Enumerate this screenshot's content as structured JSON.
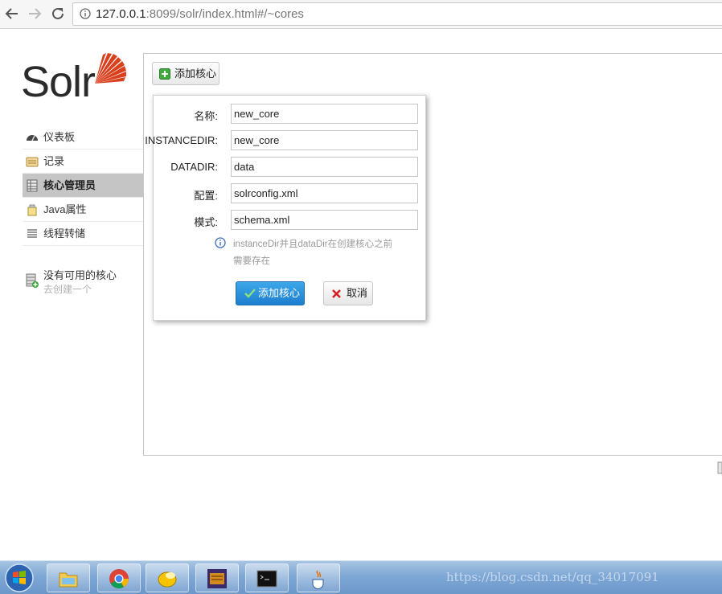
{
  "browser": {
    "url_host": "127.0.0.1",
    "url_rest": ":8099/solr/index.html#/~cores"
  },
  "logo": {
    "text": "Solr"
  },
  "sidebar": {
    "items": [
      {
        "label": "仪表板",
        "icon": "dashboard-icon"
      },
      {
        "label": "记录",
        "icon": "logging-icon"
      },
      {
        "label": "核心管理员",
        "icon": "core-admin-icon",
        "active": true
      },
      {
        "label": "Java属性",
        "icon": "java-properties-icon"
      },
      {
        "label": "线程转储",
        "icon": "thread-dump-icon"
      }
    ],
    "no_core": {
      "title": "没有可用的核心",
      "subtitle": "去创建一个"
    }
  },
  "toolbar": {
    "add_core_label": "添加核心"
  },
  "dialog": {
    "fields": [
      {
        "label": "名称:",
        "value": "new_core"
      },
      {
        "label": "INSTANCEDIR:",
        "value": "new_core"
      },
      {
        "label": "DATADIR:",
        "value": "data"
      },
      {
        "label": "配置:",
        "value": "solrconfig.xml"
      },
      {
        "label": "模式:",
        "value": "schema.xml"
      }
    ],
    "hint_line1": "instanceDir并且dataDir在创建核心之前",
    "hint_line2": "需要存在",
    "ok_label": "添加核心",
    "cancel_label": "取消"
  },
  "taskbar": {
    "apps": [
      "file-explorer",
      "chrome",
      "filezilla",
      "eclipse-javaee",
      "terminal",
      "java"
    ],
    "watermark": "https://blog.csdn.net/qq_34017091"
  },
  "colors": {
    "accent": "#1d7fd0",
    "logo_red": "#d9411e",
    "active_item": "#c5c5c5"
  }
}
